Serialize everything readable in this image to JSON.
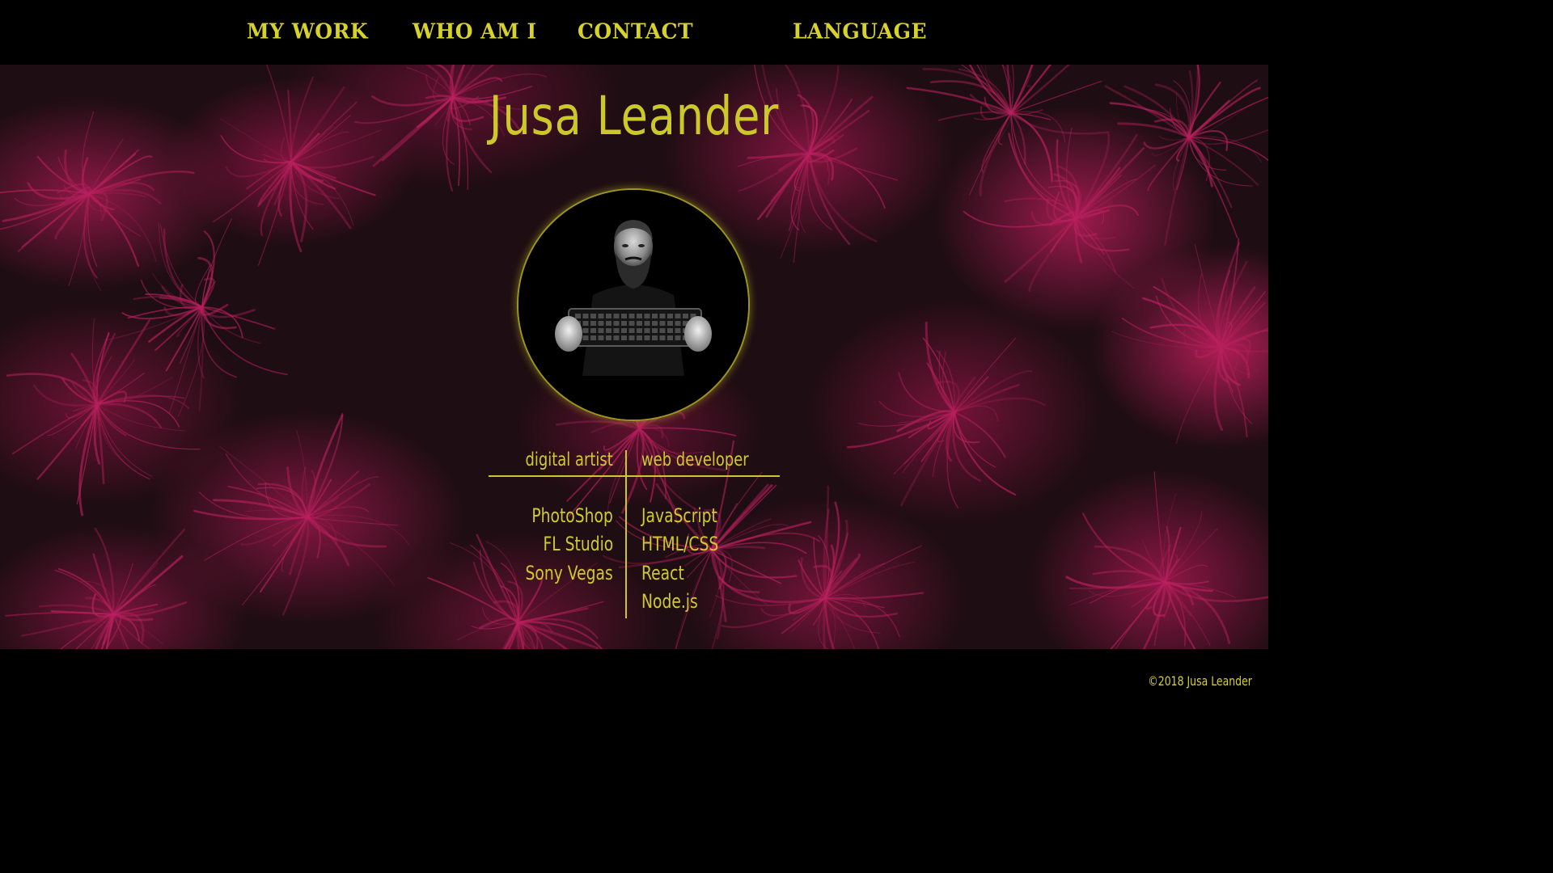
{
  "nav": {
    "items": [
      {
        "label": "MY WORK"
      },
      {
        "label": "WHO AM I"
      },
      {
        "label": "CONTACT"
      },
      {
        "label": "LANGUAGE"
      }
    ]
  },
  "hero": {
    "name": "Jusa Leander"
  },
  "skills": {
    "left_heading": "digital artist",
    "right_heading": "web developer",
    "left_items": [
      "PhotoShop",
      "FL Studio",
      "Sony Vegas"
    ],
    "right_items": [
      "JavaScript",
      "HTML/CSS",
      "React",
      "Node.js"
    ]
  },
  "footer": {
    "copyright": "©2018 Jusa Leander"
  },
  "colors": {
    "accent": "#cdc82a",
    "background": "#000000",
    "pattern": "#b01c54"
  }
}
